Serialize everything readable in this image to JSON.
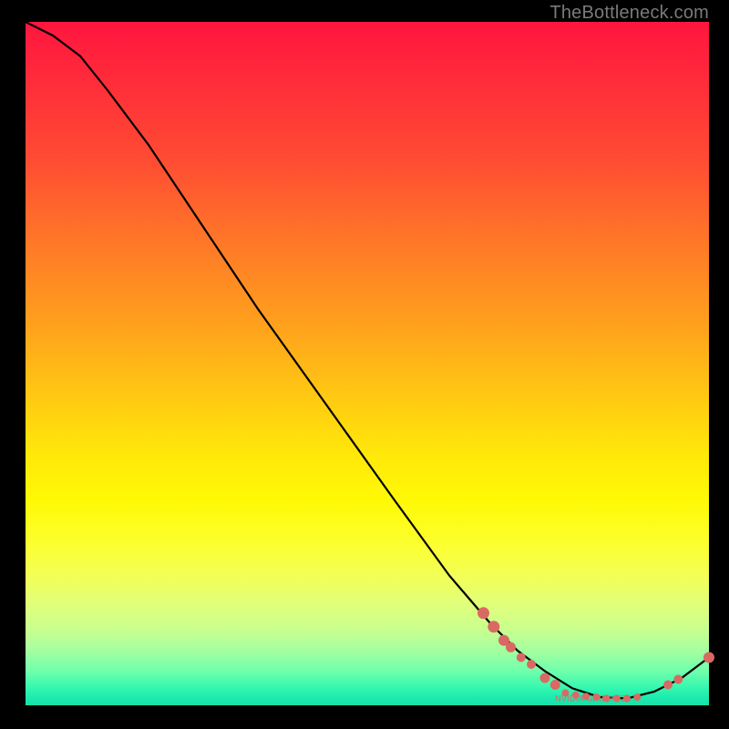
{
  "attribution": "TheBottleneck.com",
  "label_text": "NVIDIA GRID K520",
  "colors": {
    "dot": "#d96a63",
    "curve": "#000000",
    "bg_black": "#000000"
  },
  "chart_data": {
    "type": "line",
    "title": "",
    "xlabel": "",
    "ylabel": "",
    "xlim": [
      0,
      100
    ],
    "ylim": [
      0,
      100
    ],
    "grid": false,
    "legend": false,
    "curve": [
      {
        "x": 0,
        "y": 100
      },
      {
        "x": 4,
        "y": 98
      },
      {
        "x": 8,
        "y": 95
      },
      {
        "x": 12,
        "y": 90
      },
      {
        "x": 18,
        "y": 82
      },
      {
        "x": 26,
        "y": 70
      },
      {
        "x": 34,
        "y": 58
      },
      {
        "x": 44,
        "y": 44
      },
      {
        "x": 54,
        "y": 30
      },
      {
        "x": 62,
        "y": 19
      },
      {
        "x": 68,
        "y": 12
      },
      {
        "x": 72,
        "y": 8
      },
      {
        "x": 76,
        "y": 5
      },
      {
        "x": 80,
        "y": 2.5
      },
      {
        "x": 84,
        "y": 1.2
      },
      {
        "x": 88,
        "y": 1.0
      },
      {
        "x": 92,
        "y": 2.0
      },
      {
        "x": 96,
        "y": 4.0
      },
      {
        "x": 100,
        "y": 7.0
      }
    ],
    "dots": [
      {
        "x": 67,
        "y": 13.5,
        "r": 6.5
      },
      {
        "x": 68.5,
        "y": 11.5,
        "r": 6.5
      },
      {
        "x": 70,
        "y": 9.5,
        "r": 6.0
      },
      {
        "x": 71,
        "y": 8.5,
        "r": 5.5
      },
      {
        "x": 72.5,
        "y": 7.0,
        "r": 5.0
      },
      {
        "x": 74,
        "y": 6.0,
        "r": 5.0
      },
      {
        "x": 76,
        "y": 4.0,
        "r": 5.5
      },
      {
        "x": 77.5,
        "y": 3.0,
        "r": 5.5
      },
      {
        "x": 79,
        "y": 1.8,
        "r": 4.0
      },
      {
        "x": 80.5,
        "y": 1.5,
        "r": 4.0
      },
      {
        "x": 82,
        "y": 1.3,
        "r": 4.0
      },
      {
        "x": 83.5,
        "y": 1.2,
        "r": 4.0
      },
      {
        "x": 85,
        "y": 1.0,
        "r": 4.0
      },
      {
        "x": 86.5,
        "y": 1.0,
        "r": 4.0
      },
      {
        "x": 88,
        "y": 1.0,
        "r": 4.0
      },
      {
        "x": 89.5,
        "y": 1.2,
        "r": 4.0
      },
      {
        "x": 94,
        "y": 3.0,
        "r": 5.0
      },
      {
        "x": 95.5,
        "y": 3.8,
        "r": 5.0
      },
      {
        "x": 100,
        "y": 7.0,
        "r": 6.0
      }
    ],
    "label_anchor": {
      "x": 83,
      "y": 1.0
    }
  }
}
